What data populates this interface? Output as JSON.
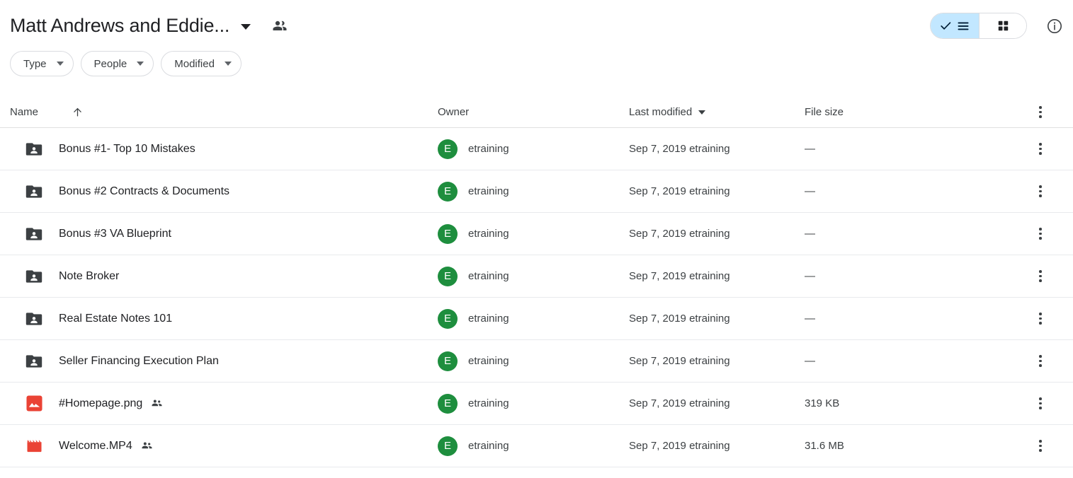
{
  "header": {
    "title": "Matt Andrews and Eddie...",
    "title_caret_icon": "chevron-down-icon",
    "shared_icon": "people-shared-icon",
    "view_toggle": {
      "list_icon": "list-view-icon",
      "list_check_icon": "check-icon",
      "grid_icon": "grid-view-icon",
      "selected": "list"
    },
    "info_icon": "info-circle-icon"
  },
  "filters": [
    {
      "label": "Type",
      "caret_icon": "chevron-down-icon"
    },
    {
      "label": "People",
      "caret_icon": "chevron-down-icon"
    },
    {
      "label": "Modified",
      "caret_icon": "chevron-down-icon"
    }
  ],
  "table": {
    "columns": {
      "name": "Name",
      "name_sort_icon": "arrow-up-icon",
      "owner": "Owner",
      "last_modified": "Last modified",
      "last_modified_caret_icon": "chevron-down-icon",
      "file_size": "File size",
      "menu_icon": "more-vertical-icon"
    },
    "rows": [
      {
        "icon": "folder-shared-icon",
        "name": "Bonus #1-  Top 10 Mistakes",
        "shared": false,
        "owner_initial": "E",
        "owner": "etraining",
        "modified": "Sep 7, 2019 etraining",
        "size": "—",
        "menu_icon": "more-vertical-icon"
      },
      {
        "icon": "folder-shared-icon",
        "name": "Bonus #2  Contracts & Documents",
        "shared": false,
        "owner_initial": "E",
        "owner": "etraining",
        "modified": "Sep 7, 2019 etraining",
        "size": "—",
        "menu_icon": "more-vertical-icon"
      },
      {
        "icon": "folder-shared-icon",
        "name": "Bonus #3 VA Blueprint",
        "shared": false,
        "owner_initial": "E",
        "owner": "etraining",
        "modified": "Sep 7, 2019 etraining",
        "size": "—",
        "menu_icon": "more-vertical-icon"
      },
      {
        "icon": "folder-shared-icon",
        "name": "Note Broker",
        "shared": false,
        "owner_initial": "E",
        "owner": "etraining",
        "modified": "Sep 7, 2019 etraining",
        "size": "—",
        "menu_icon": "more-vertical-icon"
      },
      {
        "icon": "folder-shared-icon",
        "name": "Real Estate Notes 101",
        "shared": false,
        "owner_initial": "E",
        "owner": "etraining",
        "modified": "Sep 7, 2019 etraining",
        "size": "—",
        "menu_icon": "more-vertical-icon"
      },
      {
        "icon": "folder-shared-icon",
        "name": "Seller Financing Execution Plan",
        "shared": false,
        "owner_initial": "E",
        "owner": "etraining",
        "modified": "Sep 7, 2019 etraining",
        "size": "—",
        "menu_icon": "more-vertical-icon"
      },
      {
        "icon": "image-file-icon",
        "name": "#Homepage.png",
        "shared": true,
        "owner_initial": "E",
        "owner": "etraining",
        "modified": "Sep 7, 2019 etraining",
        "size": "319 KB",
        "menu_icon": "more-vertical-icon"
      },
      {
        "icon": "video-file-icon",
        "name": "Welcome.MP4",
        "shared": true,
        "owner_initial": "E",
        "owner": "etraining",
        "modified": "Sep 7, 2019 etraining",
        "size": "31.6 MB",
        "menu_icon": "more-vertical-icon"
      }
    ]
  },
  "colors": {
    "accent_selected": "#c2e7ff",
    "avatar_green": "#1e8e3e",
    "file_red": "#ea4335",
    "folder_gray": "#3c4043",
    "divider": "#e8eaed"
  }
}
